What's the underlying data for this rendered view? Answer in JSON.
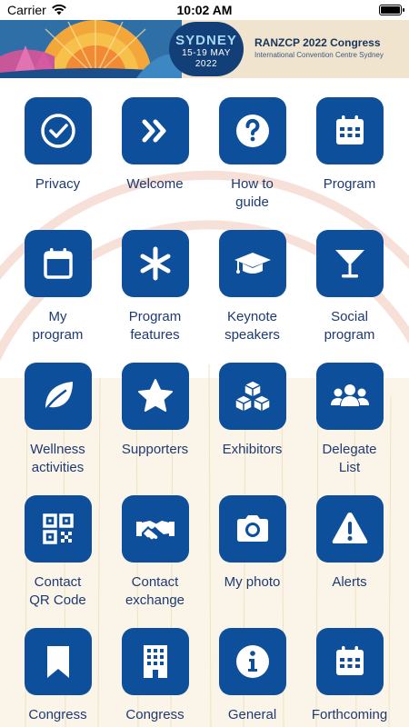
{
  "status_bar": {
    "carrier": "Carrier",
    "time": "10:02 AM"
  },
  "banner": {
    "city": "SYDNEY",
    "dates_line1": "15-19 MAY",
    "dates_line2": "2022",
    "title": "RANZCP 2022 Congress",
    "subtitle": "International Convention Centre Sydney"
  },
  "colors": {
    "tile_blue": "#0d4f9a",
    "label_blue": "#1d3a73"
  },
  "tiles": [
    {
      "label": "Privacy",
      "icon": "check-circle-icon"
    },
    {
      "label": "Welcome",
      "icon": "double-chevron-right-icon"
    },
    {
      "label": "How to\nguide",
      "icon": "question-circle-icon"
    },
    {
      "label": "Program",
      "icon": "calendar-grid-icon"
    },
    {
      "label": "My\nprogram",
      "icon": "calendar-icon"
    },
    {
      "label": "Program\nfeatures",
      "icon": "asterisk-icon"
    },
    {
      "label": "Keynote\nspeakers",
      "icon": "graduation-cap-icon"
    },
    {
      "label": "Social\nprogram",
      "icon": "cocktail-glass-icon"
    },
    {
      "label": "Wellness\nactivities",
      "icon": "leaf-icon"
    },
    {
      "label": "Supporters",
      "icon": "star-icon"
    },
    {
      "label": "Exhibitors",
      "icon": "cubes-icon"
    },
    {
      "label": "Delegate\nList",
      "icon": "users-icon"
    },
    {
      "label": "Contact\nQR Code",
      "icon": "qr-code-icon"
    },
    {
      "label": "Contact\nexchange",
      "icon": "handshake-icon"
    },
    {
      "label": "My photo",
      "icon": "camera-icon"
    },
    {
      "label": "Alerts",
      "icon": "warning-icon"
    },
    {
      "label": "Congress",
      "icon": "bookmark-icon"
    },
    {
      "label": "Congress",
      "icon": "building-icon"
    },
    {
      "label": "General",
      "icon": "info-circle-icon"
    },
    {
      "label": "Forthcoming",
      "icon": "calendar-grid-icon"
    }
  ]
}
